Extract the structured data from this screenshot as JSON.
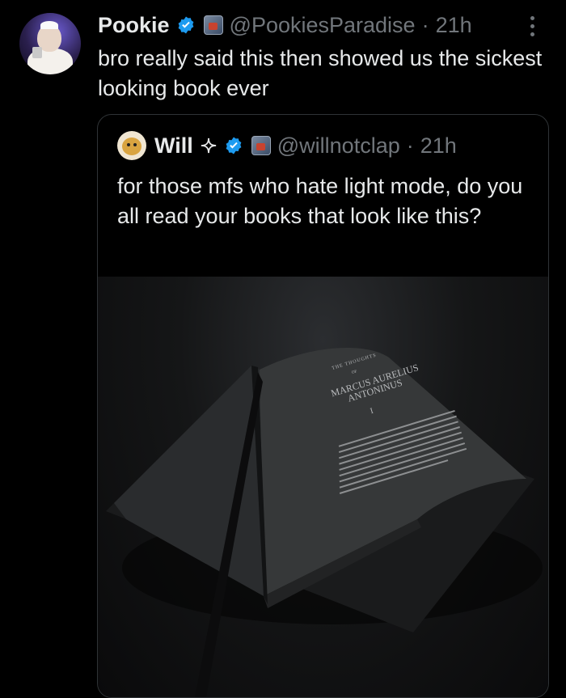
{
  "tweet": {
    "author_name": "Pookie",
    "handle": "@PookiesParadise",
    "separator": "·",
    "time": "21h",
    "text": "bro really said this then showed us the sickest looking book ever"
  },
  "quoted": {
    "author_name": "Will",
    "handle": "@willnotclap",
    "separator": "·",
    "time": "21h",
    "text": "for those mfs who hate light mode, do you all read your books that look like this?"
  },
  "book": {
    "heading": "THE THOUGHTS",
    "of": "OF",
    "title_line1": "MARCUS AURELIUS",
    "title_line2": "ANTONINUS",
    "chapter": "I"
  },
  "colors": {
    "verified_blue": "#1d9bf0",
    "muted": "#71767b",
    "text": "#e7e9ea",
    "border": "#2f3336"
  },
  "icons": [
    "verified-badge-icon",
    "affiliate-badge-icon",
    "sparkle-icon",
    "more-options-icon"
  ]
}
